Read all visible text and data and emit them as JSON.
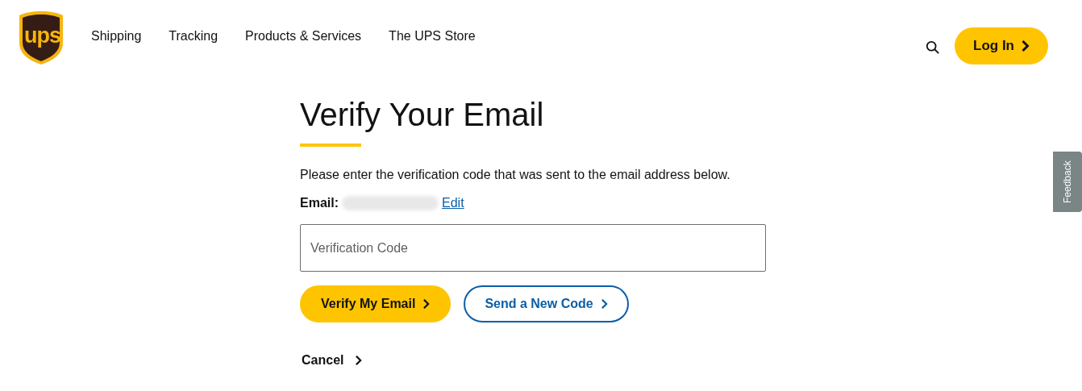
{
  "header": {
    "logo": {
      "text": "ups"
    },
    "nav": [
      {
        "label": "Shipping"
      },
      {
        "label": "Tracking"
      },
      {
        "label": "Products & Services"
      },
      {
        "label": "The UPS Store"
      }
    ],
    "login_button": "Log In"
  },
  "form": {
    "title": "Verify Your Email",
    "instructions": "Please enter the verification code that was sent to the email address below.",
    "email_label": "Email:",
    "edit_link": "Edit",
    "code_field": {
      "placeholder": "Verification Code"
    },
    "buttons": [
      {
        "label": "Verify My Email",
        "kind": "primary"
      },
      {
        "label": "Send a New Code",
        "kind": "secondary"
      }
    ],
    "cancel": "Cancel"
  },
  "feedback_tab": "Feedback"
}
